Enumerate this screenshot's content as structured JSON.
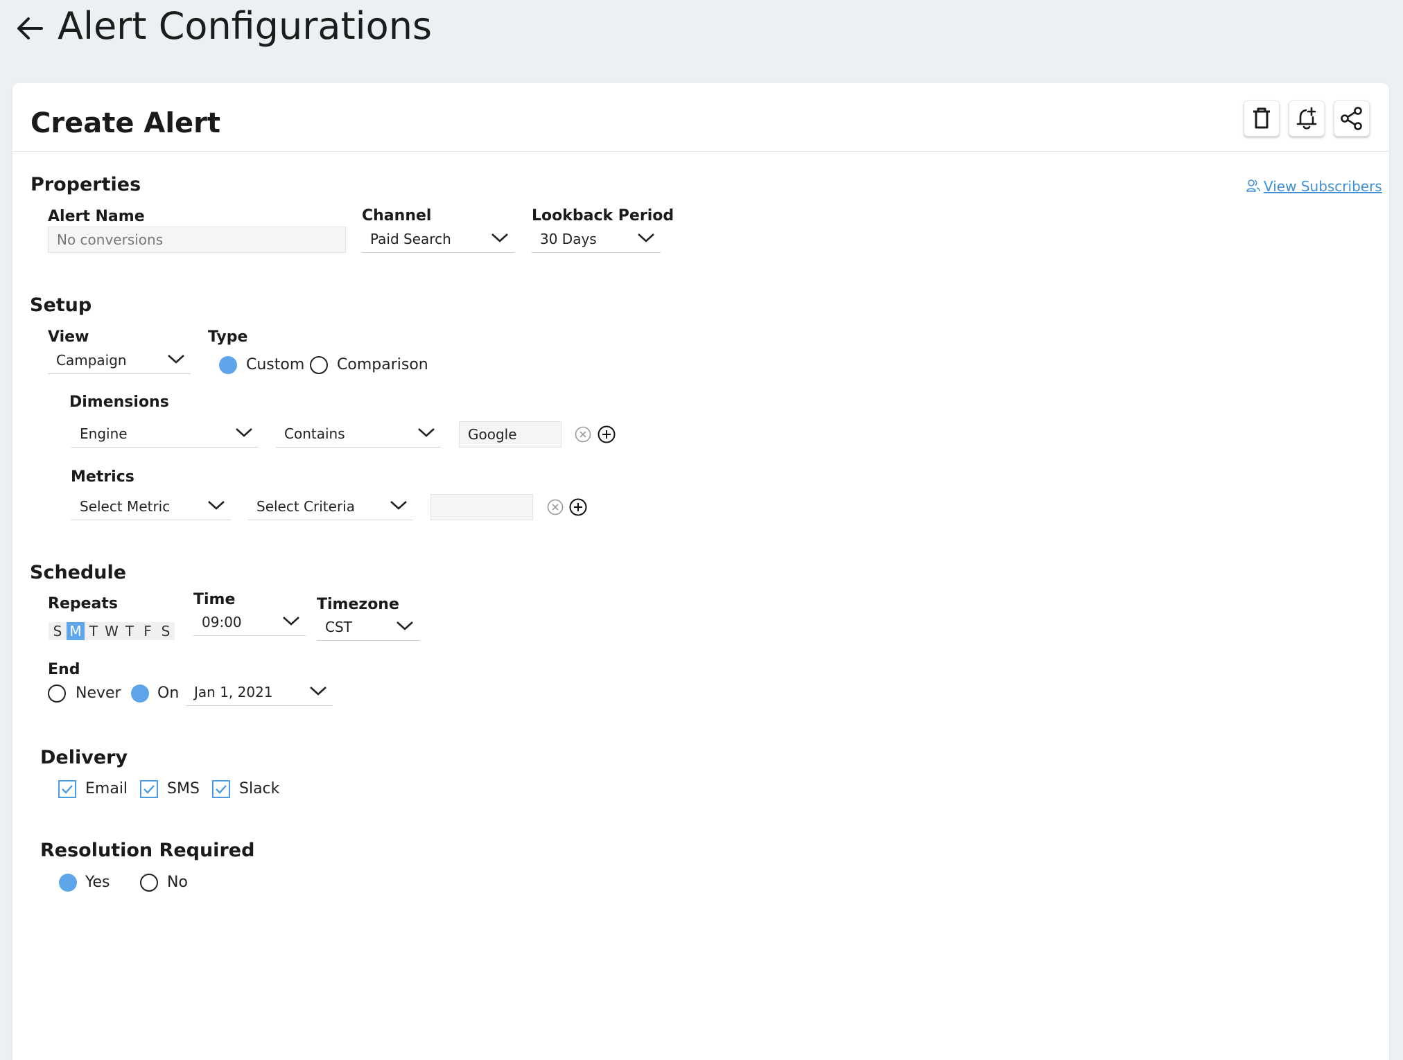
{
  "header": {
    "title": "Alert Configurations"
  },
  "card": {
    "title": "Create Alert"
  },
  "properties": {
    "title": "Properties",
    "view_subscribers": "View Subscribers",
    "alert_name_label": "Alert Name",
    "alert_name_placeholder": "No conversions",
    "channel_label": "Channel",
    "channel_value": "Paid Search",
    "lookback_label": "Lookback Period",
    "lookback_value": "30 Days"
  },
  "setup": {
    "title": "Setup",
    "view_label": "View",
    "view_value": "Campaign",
    "type_label": "Type",
    "type_options": [
      "Custom",
      "Comparison"
    ],
    "type_selected": "Custom",
    "dimensions_label": "Dimensions",
    "dimension_field": "Engine",
    "dimension_operator": "Contains",
    "dimension_value": "Google",
    "metrics_label": "Metrics",
    "metric_field": "Select Metric",
    "metric_criteria": "Select Criteria",
    "metric_value": ""
  },
  "schedule": {
    "title": "Schedule",
    "repeats_label": "Repeats",
    "days": [
      "S",
      "M",
      "T",
      "W",
      "T",
      "F",
      "S"
    ],
    "selected_day_index": 1,
    "time_label": "Time",
    "time_value": "09:00",
    "timezone_label": "Timezone",
    "timezone_value": "CST",
    "end_label": "End",
    "end_options": [
      "Never",
      "On"
    ],
    "end_selected": "On",
    "end_date": "Jan 1, 2021"
  },
  "delivery": {
    "title": "Delivery",
    "options": [
      "Email",
      "SMS",
      "Slack"
    ],
    "checked": [
      true,
      true,
      true
    ]
  },
  "resolution": {
    "title": "Resolution Required",
    "options": [
      "Yes",
      "No"
    ],
    "selected": "Yes"
  },
  "colors": {
    "accent": "#5da5e8",
    "link": "#3f8fd6",
    "background": "#ebf0f2"
  }
}
